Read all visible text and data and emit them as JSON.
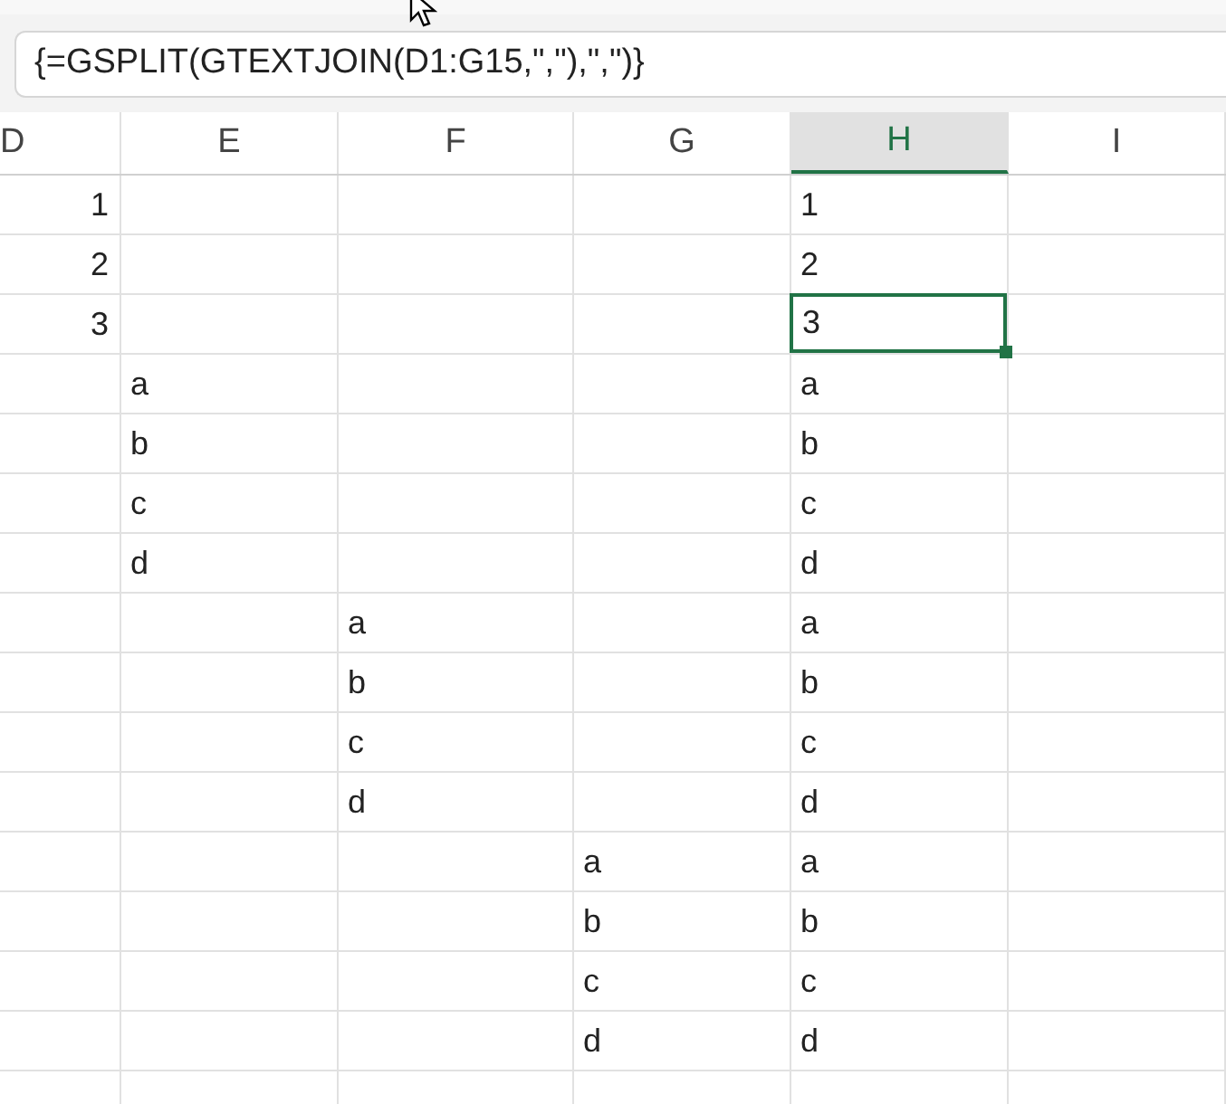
{
  "formula_bar": {
    "value": "{=GSPLIT(GTEXTJOIN(D1:G15,\",\"),\",\")}"
  },
  "columns": [
    {
      "label": "D",
      "selected": false
    },
    {
      "label": "E",
      "selected": false
    },
    {
      "label": "F",
      "selected": false
    },
    {
      "label": "G",
      "selected": false
    },
    {
      "label": "H",
      "selected": true
    },
    {
      "label": "I",
      "selected": false
    }
  ],
  "rows": [
    {
      "cells": [
        {
          "value": "1",
          "kind": "number",
          "selected": false
        },
        null,
        null,
        null,
        {
          "value": "1",
          "kind": "text",
          "selected": false
        },
        null
      ]
    },
    {
      "cells": [
        {
          "value": "2",
          "kind": "number",
          "selected": false
        },
        null,
        null,
        null,
        {
          "value": "2",
          "kind": "text",
          "selected": false
        },
        null
      ]
    },
    {
      "cells": [
        {
          "value": "3",
          "kind": "number",
          "selected": false
        },
        null,
        null,
        null,
        {
          "value": "3",
          "kind": "text",
          "selected": true
        },
        null
      ]
    },
    {
      "cells": [
        null,
        {
          "value": "a",
          "kind": "text",
          "selected": false
        },
        null,
        null,
        {
          "value": "a",
          "kind": "text",
          "selected": false
        },
        null
      ]
    },
    {
      "cells": [
        null,
        {
          "value": "b",
          "kind": "text",
          "selected": false
        },
        null,
        null,
        {
          "value": "b",
          "kind": "text",
          "selected": false
        },
        null
      ]
    },
    {
      "cells": [
        null,
        {
          "value": "c",
          "kind": "text",
          "selected": false
        },
        null,
        null,
        {
          "value": "c",
          "kind": "text",
          "selected": false
        },
        null
      ]
    },
    {
      "cells": [
        null,
        {
          "value": "d",
          "kind": "text",
          "selected": false
        },
        null,
        null,
        {
          "value": "d",
          "kind": "text",
          "selected": false
        },
        null
      ]
    },
    {
      "cells": [
        null,
        null,
        {
          "value": "a",
          "kind": "text",
          "selected": false
        },
        null,
        {
          "value": "a",
          "kind": "text",
          "selected": false
        },
        null
      ]
    },
    {
      "cells": [
        null,
        null,
        {
          "value": "b",
          "kind": "text",
          "selected": false
        },
        null,
        {
          "value": "b",
          "kind": "text",
          "selected": false
        },
        null
      ]
    },
    {
      "cells": [
        null,
        null,
        {
          "value": "c",
          "kind": "text",
          "selected": false
        },
        null,
        {
          "value": "c",
          "kind": "text",
          "selected": false
        },
        null
      ]
    },
    {
      "cells": [
        null,
        null,
        {
          "value": "d",
          "kind": "text",
          "selected": false
        },
        null,
        {
          "value": "d",
          "kind": "text",
          "selected": false
        },
        null
      ]
    },
    {
      "cells": [
        null,
        null,
        null,
        {
          "value": "a",
          "kind": "text",
          "selected": false
        },
        {
          "value": "a",
          "kind": "text",
          "selected": false
        },
        null
      ]
    },
    {
      "cells": [
        null,
        null,
        null,
        {
          "value": "b",
          "kind": "text",
          "selected": false
        },
        {
          "value": "b",
          "kind": "text",
          "selected": false
        },
        null
      ]
    },
    {
      "cells": [
        null,
        null,
        null,
        {
          "value": "c",
          "kind": "text",
          "selected": false
        },
        {
          "value": "c",
          "kind": "text",
          "selected": false
        },
        null
      ]
    },
    {
      "cells": [
        null,
        null,
        null,
        {
          "value": "d",
          "kind": "text",
          "selected": false
        },
        {
          "value": "d",
          "kind": "text",
          "selected": false
        },
        null
      ]
    }
  ]
}
